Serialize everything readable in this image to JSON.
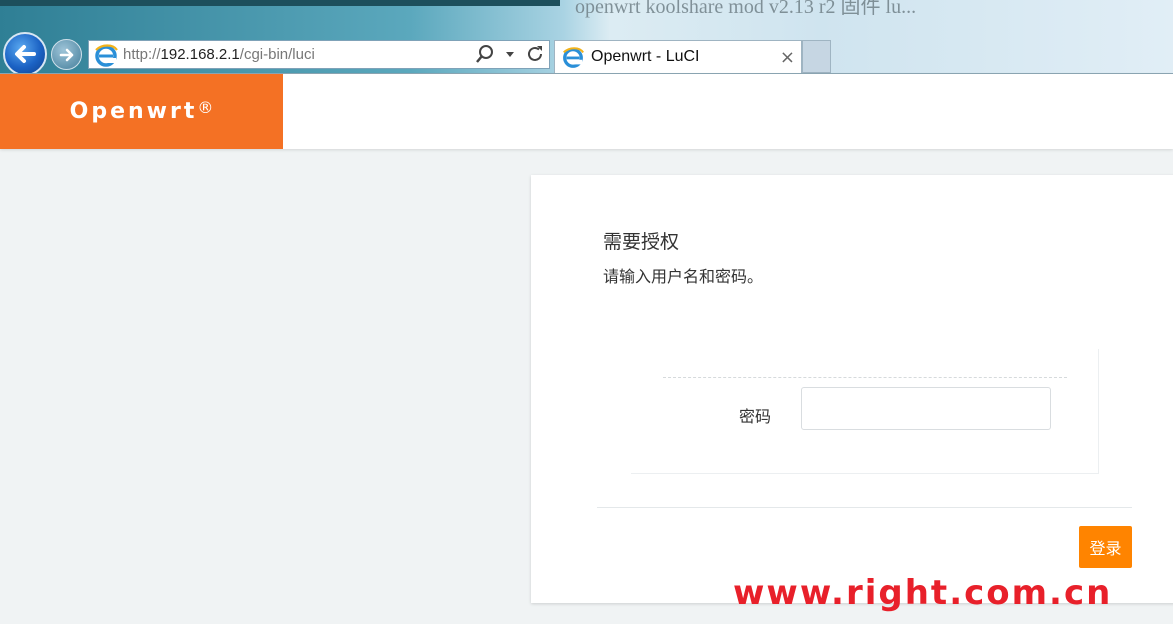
{
  "browser": {
    "url_prefix": "http://",
    "url_host": "192.168.2.1",
    "url_path": "/cgi-bin/luci",
    "tab_title": "Openwrt - LuCI",
    "tab_close": "×",
    "background_text": "openwrt koolshare mod v2.13 r2 固件 lu...",
    "icons": [
      "back-icon",
      "forward-icon",
      "ie-icon",
      "search-icon",
      "dropdown-icon",
      "refresh-icon",
      "close-icon"
    ]
  },
  "header": {
    "brand": "Openwrt",
    "brand_mark": "®",
    "brand_color": "#f47124"
  },
  "login": {
    "title": "需要授权",
    "description": "请输入用户名和密码。",
    "password_label": "密码",
    "password_value": "",
    "submit_label": "登录",
    "submit_color": "#ff8400"
  },
  "watermark": "www.right.com.cn"
}
